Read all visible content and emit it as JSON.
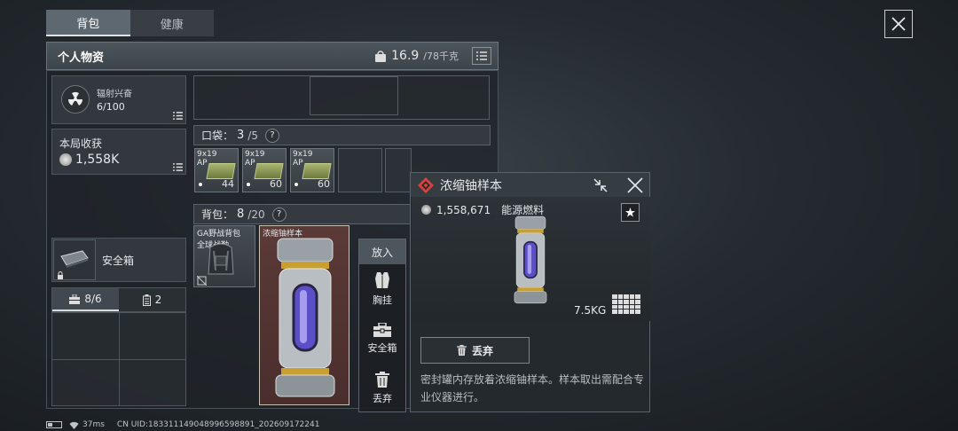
{
  "tabs": [
    {
      "label": "背包",
      "active": true
    },
    {
      "label": "健康",
      "active": false
    }
  ],
  "header": {
    "title": "个人物资",
    "weight_current": "16.9",
    "weight_max": "/78千克"
  },
  "left": {
    "radiation": {
      "label": "辐射兴奋",
      "value": "6/100"
    },
    "harvest": {
      "label": "本局收获",
      "value": "1,558K"
    },
    "safe_box": {
      "label": "安全箱"
    },
    "subtabs": [
      {
        "label": "8/6",
        "icon": "toolbox-icon"
      },
      {
        "label": "2",
        "icon": "battery-icon"
      }
    ]
  },
  "pocket": {
    "label": "口袋：",
    "count": "3",
    "max": "/5",
    "help": "?"
  },
  "ammo": [
    {
      "line1": "9x19",
      "line2": "AP",
      "count": "44"
    },
    {
      "line1": "9x19",
      "line2": "AP",
      "count": "60"
    },
    {
      "line1": "9x19",
      "line2": "AP",
      "count": "60"
    }
  ],
  "backpack": {
    "label": "背包：",
    "count": "8",
    "max": "/20",
    "help": "?"
  },
  "items": {
    "bag": {
      "line1": "GA野战背包",
      "line2": "全球战勤"
    },
    "uranium": {
      "label": "浓缩铀样本"
    }
  },
  "context_menu": {
    "title": "放入",
    "items": [
      {
        "label": "胸挂",
        "icon": "vest-icon"
      },
      {
        "label": "安全箱",
        "icon": "safe-box-icon"
      },
      {
        "label": "丢弃",
        "icon": "trash-icon"
      }
    ]
  },
  "detail": {
    "name": "浓缩铀样本",
    "price": "1,558,671",
    "category": "能源燃料",
    "weight": "7.5KG",
    "discard_label": "丢弃",
    "description": "密封罐内存放着浓缩铀样本。样本取出需配合专业仪器进行。"
  },
  "status": {
    "ping": "37ms",
    "uid": "CN UID:18331114904899659889​1_202609172241"
  },
  "colors": {
    "accent_red": "#d8423c",
    "item_highlight": "#5b3a37"
  }
}
